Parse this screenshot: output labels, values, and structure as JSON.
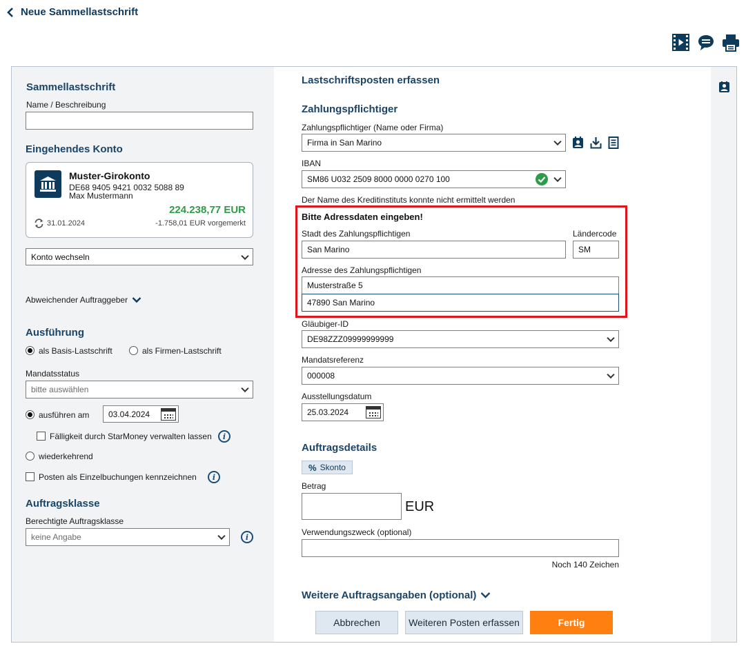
{
  "header": {
    "back_label": "Neue Sammellastschrift"
  },
  "left": {
    "section_title": "Sammellastschrift",
    "name_label": "Name / Beschreibung",
    "name_value": "",
    "account_section_title": "Eingehendes Konto",
    "account": {
      "name": "Muster-Girokonto",
      "iban": "DE68 9405 9421 0032 5088 89",
      "owner": "Max Mustermann",
      "balance": "224.238,77 EUR",
      "sync_date": "31.01.2024",
      "pending": "-1.758,01 EUR vorgemerkt"
    },
    "switch_account": "Konto wechseln",
    "alt_orderer": "Abweichender Auftraggeber",
    "execution_title": "Ausführung",
    "radio_basis": "als Basis-Lastschrift",
    "radio_firmen": "als Firmen-Lastschrift",
    "mandate_status_label": "Mandatsstatus",
    "mandate_status_placeholder": "bitte auswählen",
    "execute_on_label": "ausführen am",
    "execute_on_date": "03.04.2024",
    "due_managed_label": "Fälligkeit durch StarMoney verwalten lassen",
    "recurring_label": "wiederkehrend",
    "single_bookings_label": "Posten als Einzelbuchungen kennzeichnen",
    "order_class_title": "Auftragsklasse",
    "order_class_label": "Berechtigte Auftragsklasse",
    "order_class_value": "keine Angabe"
  },
  "right": {
    "section_title": "Lastschriftsposten erfassen",
    "payer_title": "Zahlungspflichtiger",
    "payer_label": "Zahlungspflichtiger (Name oder Firma)",
    "payer_value": "Firma in San Marino",
    "iban_label": "IBAN",
    "iban_value": "SM86 U032 2509 8000 0000 0270 100",
    "bank_not_found": "Der Name des Kreditinstituts konnte nicht ermittelt werden",
    "address_prompt": "Bitte Adressdaten eingeben!",
    "city_label": "Stadt des Zahlungspflichtigen",
    "city_value": "San Marino",
    "country_code_label": "Ländercode",
    "country_code_value": "SM",
    "address_label": "Adresse des Zahlungspflichtigen",
    "address_line1": "Musterstraße 5",
    "address_line2": "47890 San Marino",
    "creditor_id_label": "Gläubiger-ID",
    "creditor_id_value": "DE98ZZZ09999999999",
    "mandate_ref_label": "Mandatsreferenz",
    "mandate_ref_value": "000008",
    "issue_date_label": "Ausstellungsdatum",
    "issue_date_value": "25.03.2024",
    "order_details_title": "Auftragsdetails",
    "skonto_label": "Skonto",
    "amount_label": "Betrag",
    "amount_value": "",
    "currency": "EUR",
    "purpose_label": "Verwendungszweck (optional)",
    "purpose_value": "",
    "chars_left": "Noch 140 Zeichen",
    "more_details": "Weitere Auftragsangaben (optional)"
  },
  "buttons": {
    "cancel": "Abbrechen",
    "add_more": "Weiteren Posten erfassen",
    "done": "Fertig"
  },
  "colors": {
    "navy": "#1b4466",
    "orange": "#ff7f11",
    "green": "#2e9b48",
    "highlight_red": "#e0141b",
    "panel_gray": "#f1f3f5"
  }
}
